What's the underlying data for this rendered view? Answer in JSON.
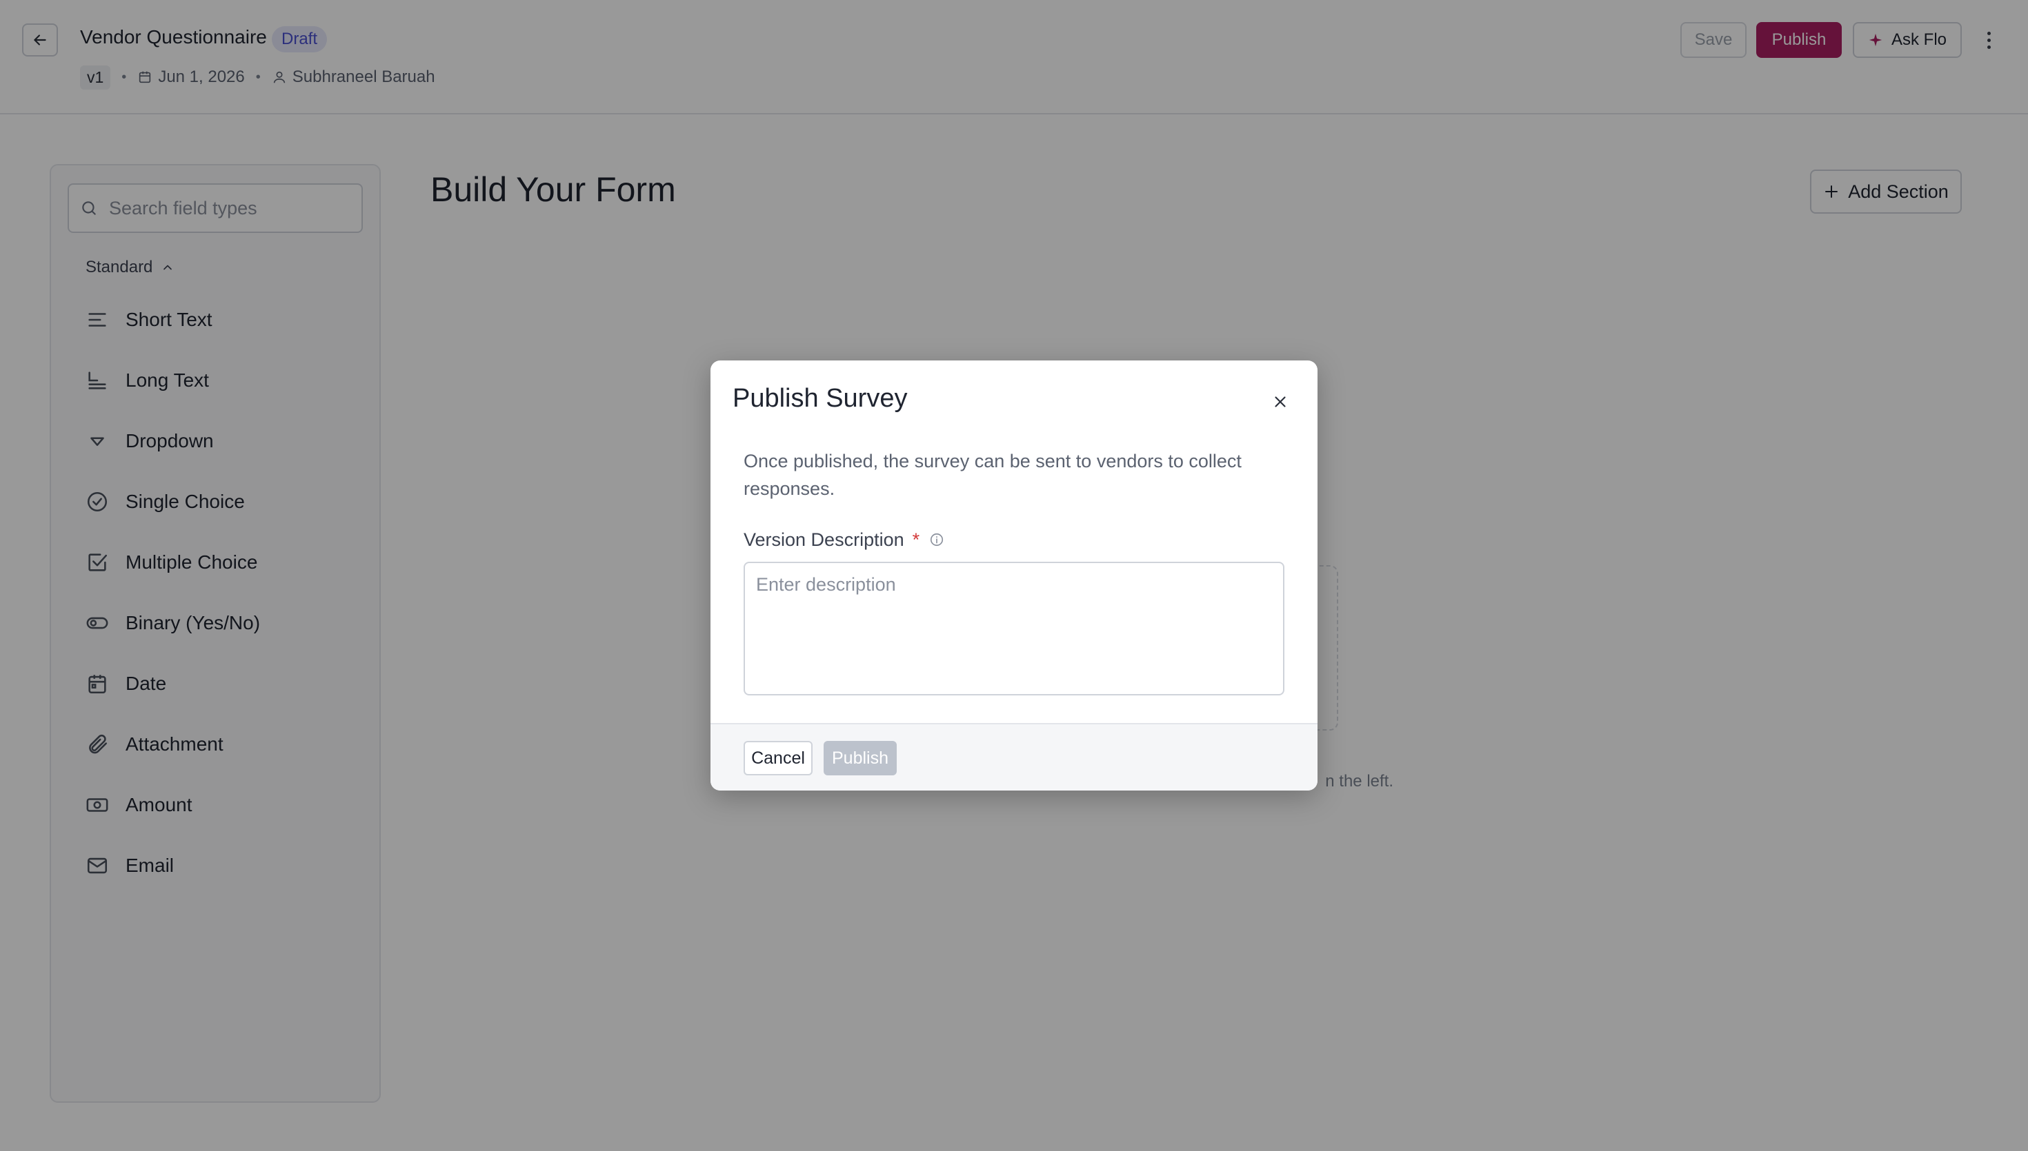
{
  "header": {
    "title": "Vendor Questionnaire",
    "status_badge": "Draft",
    "version": "v1",
    "date": "Jun 1, 2026",
    "author": "Subhraneel Baruah",
    "save_label": "Save",
    "publish_label": "Publish",
    "ask_flo_label": "Ask Flo"
  },
  "sidebar": {
    "search_placeholder": "Search field types",
    "group_label": "Standard",
    "items": [
      {
        "label": "Short Text",
        "icon": "short-text-icon"
      },
      {
        "label": "Long Text",
        "icon": "long-text-icon"
      },
      {
        "label": "Dropdown",
        "icon": "dropdown-icon"
      },
      {
        "label": "Single Choice",
        "icon": "single-choice-icon"
      },
      {
        "label": "Multiple Choice",
        "icon": "multiple-choice-icon"
      },
      {
        "label": "Binary (Yes/No)",
        "icon": "toggle-icon"
      },
      {
        "label": "Date",
        "icon": "calendar-icon"
      },
      {
        "label": "Attachment",
        "icon": "paperclip-icon"
      },
      {
        "label": "Amount",
        "icon": "money-icon"
      },
      {
        "label": "Email",
        "icon": "mail-icon"
      }
    ]
  },
  "main": {
    "title": "Build Your Form",
    "add_section_label": "Add Section",
    "empty_hint_visible": "n the left."
  },
  "modal": {
    "title": "Publish Survey",
    "description": "Once published, the survey can be sent to vendors to collect responses.",
    "field_label": "Version Description",
    "required_marker": "*",
    "textarea_placeholder": "Enter description",
    "textarea_value": "",
    "cancel_label": "Cancel",
    "publish_label": "Publish"
  },
  "colors": {
    "brand_primary": "#a81e62",
    "draft_badge_bg": "#e6e8fb",
    "draft_badge_text": "#4a4fcf",
    "disabled_button": "#bcc2cc",
    "required_star": "#d33a3a"
  }
}
